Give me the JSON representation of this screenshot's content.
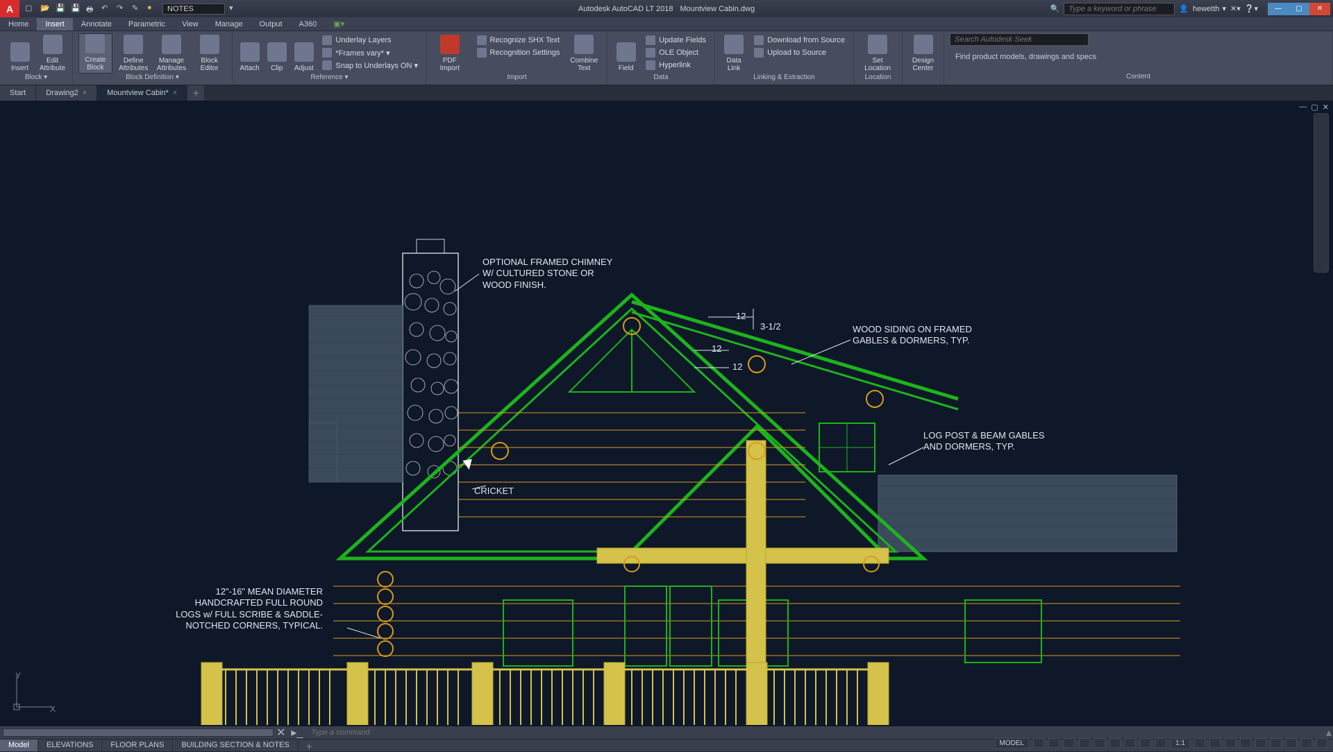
{
  "title": {
    "app": "Autodesk AutoCAD LT 2018",
    "file": "Mountview Cabin.dwg"
  },
  "qat_combo": "NOTES",
  "search_placeholder": "Type a keyword or phrase",
  "user": "hewetth",
  "menu": {
    "home": "Home",
    "insert": "Insert",
    "annotate": "Annotate",
    "parametric": "Parametric",
    "view": "View",
    "manage": "Manage",
    "output": "Output",
    "a360": "A360"
  },
  "ribbon": {
    "block": {
      "insert": "Insert",
      "edit_attr": "Edit Attribute",
      "create": "Create Block",
      "define": "Define Attributes",
      "manage": "Manage Attributes",
      "editor": "Block Editor",
      "title": "Block ▾",
      "title2": "Block Definition ▾"
    },
    "reference": {
      "attach": "Attach",
      "clip": "Clip",
      "adjust": "Adjust",
      "underlay": "Underlay Layers",
      "frames": "*Frames vary* ▾",
      "snap": "Snap to Underlays ON ▾",
      "title": "Reference ▾"
    },
    "import": {
      "pdf": "PDF Import",
      "shx": "Recognize SHX Text",
      "recset": "Recognition Settings",
      "combine": "Combine Text",
      "title": "Import"
    },
    "data": {
      "field": "Field",
      "update": "Update Fields",
      "ole": "OLE Object",
      "hyper": "Hyperlink",
      "datalink": "Data Link",
      "download": "Download from Source",
      "upload": "Upload to Source",
      "title": "Data",
      "title2": "Linking & Extraction"
    },
    "location": {
      "set": "Set Location",
      "title": "Location"
    },
    "design": {
      "dc": "Design Center"
    },
    "content": {
      "search": "Search Autodesk Seek",
      "desc": "Find product models, drawings and specs",
      "title": "Content"
    }
  },
  "file_tabs": {
    "start": "Start",
    "d2": "Drawing2",
    "mc": "Mountview Cabin*"
  },
  "annotations": {
    "chimney": "OPTIONAL FRAMED CHIMNEY W/ CULTURED STONE OR WOOD FINISH.",
    "cricket": "CRICKET",
    "siding": "WOOD SIDING ON FRAMED GABLES & DORMERS, TYP.",
    "postbeam": "LOG POST & BEAM GABLES AND DORMERS, TYP.",
    "logs": "12\"-16\" MEAN DIAMETER HANDCRAFTED FULL ROUND LOGS w/ FULL SCRIBE & SADDLE-NOTCHED CORNERS, TYPICAL."
  },
  "dims": {
    "d1": "12",
    "d2": "12",
    "d3": "12",
    "slope": "3-1/2"
  },
  "cmd_placeholder": "Type a command",
  "doc_tabs": {
    "model": "Model",
    "elev": "ELEVATIONS",
    "floor": "FLOOR PLANS",
    "section": "BUILDING SECTION & NOTES"
  },
  "status": {
    "model": "MODEL",
    "scale": "1:1"
  },
  "ucs": {
    "x": "X",
    "y": "Y"
  }
}
